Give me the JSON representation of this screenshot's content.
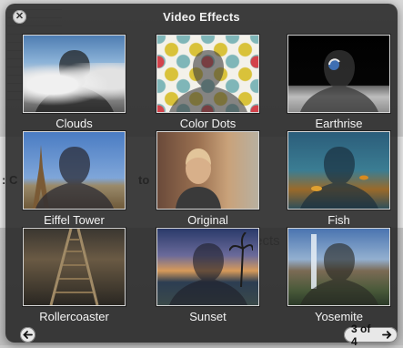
{
  "window": {
    "title": "Video Effects"
  },
  "background": {
    "text_left": ": C",
    "text_to": "to",
    "text_effects": "fects"
  },
  "effects": [
    {
      "label": "Clouds"
    },
    {
      "label": "Color Dots"
    },
    {
      "label": "Earthrise"
    },
    {
      "label": "Eiffel Tower"
    },
    {
      "label": "Original"
    },
    {
      "label": "Fish"
    },
    {
      "label": "Rollercoaster"
    },
    {
      "label": "Sunset"
    },
    {
      "label": "Yosemite"
    }
  ],
  "pagination": {
    "text": "3 of 4"
  },
  "colors": {
    "hud_bg": "#222222",
    "label_text": "#f4f4f4"
  },
  "icons": {
    "close": "close-icon",
    "prev": "arrow-left-icon",
    "next": "arrow-right-icon"
  }
}
